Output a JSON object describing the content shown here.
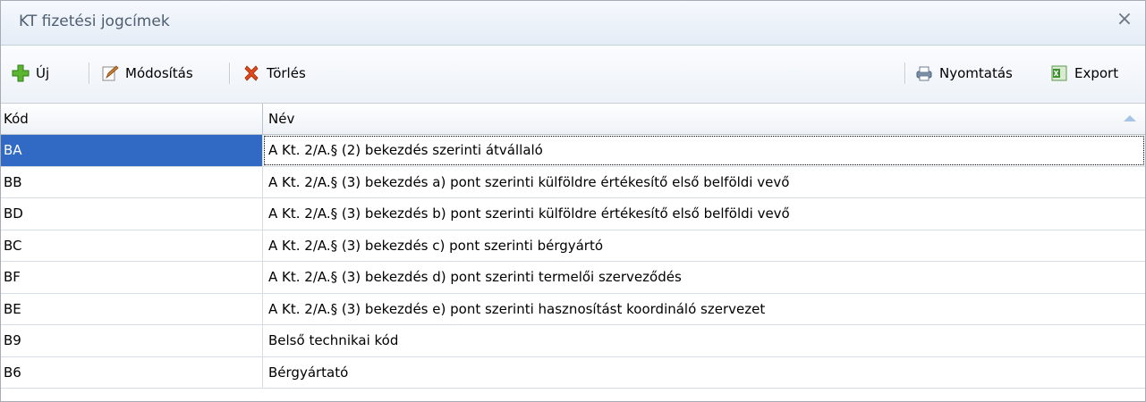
{
  "window": {
    "title": "KT fizetési jogcímek",
    "close_glyph": "×"
  },
  "toolbar": {
    "new_label": "Új",
    "edit_label": "Módosítás",
    "delete_label": "Törlés",
    "print_label": "Nyomtatás",
    "export_label": "Export",
    "icons": {
      "new": "plus-icon",
      "edit": "edit-icon",
      "delete": "delete-x-icon",
      "print": "printer-icon",
      "export": "excel-icon"
    }
  },
  "grid": {
    "columns": [
      "Kód",
      "Név"
    ],
    "sorted_column": "Név",
    "rows": [
      {
        "code": "BA",
        "name": "A Kt. 2/A.§ (2) bekezdés szerinti átvállaló",
        "selected": true
      },
      {
        "code": "BB",
        "name": "A Kt. 2/A.§ (3) bekezdés a) pont szerinti külföldre értékesítő első belföldi vevő"
      },
      {
        "code": "BD",
        "name": "A Kt. 2/A.§ (3) bekezdés b) pont szerinti külföldre értékesítő első belföldi vevő"
      },
      {
        "code": "BC",
        "name": "A Kt. 2/A.§ (3) bekezdés c) pont szerinti bérgyártó"
      },
      {
        "code": "BF",
        "name": "A Kt. 2/A.§ (3) bekezdés d) pont szerinti termelői szerveződés"
      },
      {
        "code": "BE",
        "name": "A Kt. 2/A.§ (3) bekezdés e) pont szerinti  hasznosítást koordináló szervezet"
      },
      {
        "code": "B9",
        "name": "Belső technikai kód"
      },
      {
        "code": "B6",
        "name": "Bérgyártató"
      }
    ]
  },
  "colors": {
    "selection": "#316ac5",
    "title_text": "#4d5d72"
  }
}
